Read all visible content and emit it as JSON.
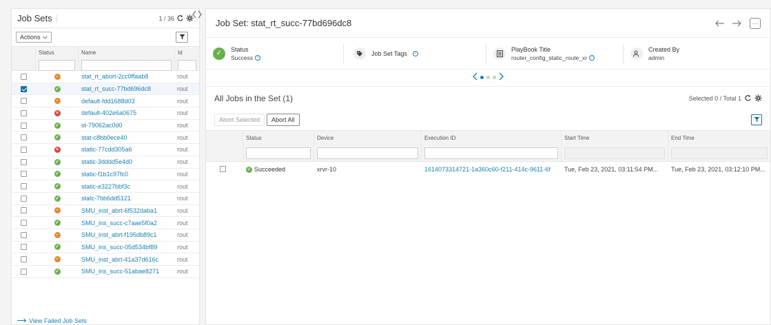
{
  "left": {
    "title": "Job Sets",
    "count": "1 / 36",
    "actions_label": "Actions",
    "columns": {
      "status": "Status",
      "name": "Name",
      "id": "Id"
    },
    "rows": [
      {
        "status": "abort",
        "name": "stat_rt_abort-2cc0ffaab8",
        "id": "rout",
        "checked": false
      },
      {
        "status": "ok",
        "name": "stat_rt_succ-77bd696dc8",
        "id": "rout",
        "checked": true
      },
      {
        "status": "abort",
        "name": "default-fdd1688d03",
        "id": "rout",
        "checked": false
      },
      {
        "status": "fail",
        "name": "default-402e6a0675",
        "id": "rout",
        "checked": false
      },
      {
        "status": "ok",
        "name": "st-79062ac0d0",
        "id": "rout",
        "checked": false
      },
      {
        "status": "ok",
        "name": "stat-c8bb0ece40",
        "id": "rout",
        "checked": false
      },
      {
        "status": "fail",
        "name": "static-77cdd305a6",
        "id": "rout",
        "checked": false
      },
      {
        "status": "ok",
        "name": "static-3dddd5e4d0",
        "id": "rout",
        "checked": false
      },
      {
        "status": "ok",
        "name": "static-f1b1c97fc0",
        "id": "rout",
        "checked": false
      },
      {
        "status": "ok",
        "name": "static-e3227bbf3c",
        "id": "rout",
        "checked": false
      },
      {
        "status": "ok",
        "name": "statc-7bb6dd5121",
        "id": "rout",
        "checked": false
      },
      {
        "status": "abort",
        "name": "SMU_inst_abrt-6f532daba1",
        "id": "rout",
        "checked": false
      },
      {
        "status": "ok",
        "name": "SMU_ins_succ-c7aae5f0a2",
        "id": "rout",
        "checked": false
      },
      {
        "status": "abort",
        "name": "SMU_inst_abrt-f195db89c1",
        "id": "rout",
        "checked": false
      },
      {
        "status": "ok",
        "name": "SMU_ins_succ-05d534bf89",
        "id": "rout",
        "checked": false
      },
      {
        "status": "abort",
        "name": "SMU_inst_abrt-41a37d616c",
        "id": "rout",
        "checked": false
      },
      {
        "status": "ok",
        "name": "SMU_ins_succ-51abae8271",
        "id": "rout",
        "checked": false
      }
    ],
    "view_failed": "View Failed Job Sets"
  },
  "right": {
    "title": "Job Set: stat_rt_succ-77bd696dc8",
    "summary": {
      "status_label": "Status",
      "status_value": "Success",
      "tags_label": "Job Set Tags",
      "playbook_label": "PlayBook Title",
      "playbook_value": "router_config_static_route_xr",
      "created_label": "Created By",
      "created_value": "admin"
    },
    "jobs_title": "All Jobs in the Set (1)",
    "selection": "Selected 0 / Total 1",
    "abort_selected": "Abort Selected",
    "abort_all": "Abort All",
    "columns": {
      "status": "Status",
      "device": "Device",
      "exec": "Execution ID",
      "start": "Start Time",
      "end": "End Time"
    },
    "jobs": [
      {
        "status": "Succeeded",
        "device": "xrvr-10",
        "exec": "1614073314721-1a360c60-f211-414c-9611-6f",
        "start": "Tue, Feb 23, 2021, 03:11:54 PM...",
        "end": "Tue, Feb 23, 2021, 03:12:10 PM..."
      }
    ]
  },
  "colors": {
    "link": "#1b7fb0",
    "success": "#6ab04c",
    "abort": "#e58a26",
    "fail": "#d9443a"
  }
}
